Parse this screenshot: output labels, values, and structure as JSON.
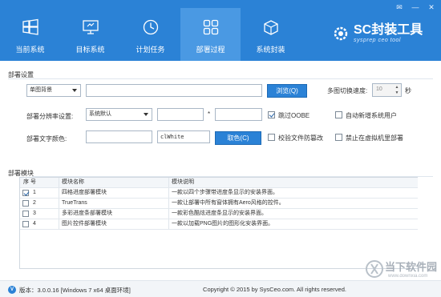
{
  "window": {
    "controls": [
      "✉",
      "—",
      "✕"
    ]
  },
  "tabs": [
    {
      "label": "当前系统",
      "icon": "windows-icon"
    },
    {
      "label": "目标系统",
      "icon": "monitor-icon"
    },
    {
      "label": "计划任务",
      "icon": "clock-icon"
    },
    {
      "label": "部署过程",
      "icon": "grid-icon",
      "active": true
    },
    {
      "label": "系统封装",
      "icon": "package-icon"
    }
  ],
  "logo": {
    "main": "SC封装工具",
    "sub": "sysprep ceo tool"
  },
  "deploy_settings": {
    "title": "部署设置",
    "background_select": "单图背景",
    "browse_label": "浏览(Q)",
    "switch_speed_label": "多图切换速度:",
    "switch_speed_value": "10",
    "seconds_unit": "秒",
    "resolution_label": "部署分辨率设置:",
    "resolution_select": "系统默认",
    "times": "*",
    "skip_oobe_label": "跳过OOBE",
    "skip_oobe_checked": true,
    "auto_new_user_label": "自动新增系统用户",
    "text_color_label": "部署文字颜色:",
    "color_value": "clWhite",
    "pick_color_label": "取色(C)",
    "verify_label": "校验文件防篡改",
    "vm_label": "禁止在虚拟机里部署"
  },
  "modules": {
    "title": "部署模块",
    "headers": [
      "序 号",
      "模块名称",
      "模块说明"
    ],
    "rows": [
      {
        "num": "1",
        "name": "四格进度部署模块",
        "desc": "一款以四个步骤带进度条显示的安装界面。",
        "checked": true
      },
      {
        "num": "2",
        "name": "TrueTrans",
        "desc": "一款让部署中所有窗体拥有Aero风格的控件。",
        "checked": false
      },
      {
        "num": "3",
        "name": "多彩进度条部署模块",
        "desc": "一款彩色酷炫进度条显示的安装界面。",
        "checked": false
      },
      {
        "num": "4",
        "name": "图片控件部署模块",
        "desc": "一款以加载PNG图片的图形化安装界面。",
        "checked": false
      }
    ]
  },
  "footer": {
    "version_icon": "V",
    "version": "版本：3.0.0.16 [Windows 7 x64 桌面环境]",
    "copyright": "Copyright © 2015 by SysCeo.com. All rights reserved."
  },
  "watermark": {
    "text": "当下软件园",
    "url": "www.downxia.com"
  }
}
